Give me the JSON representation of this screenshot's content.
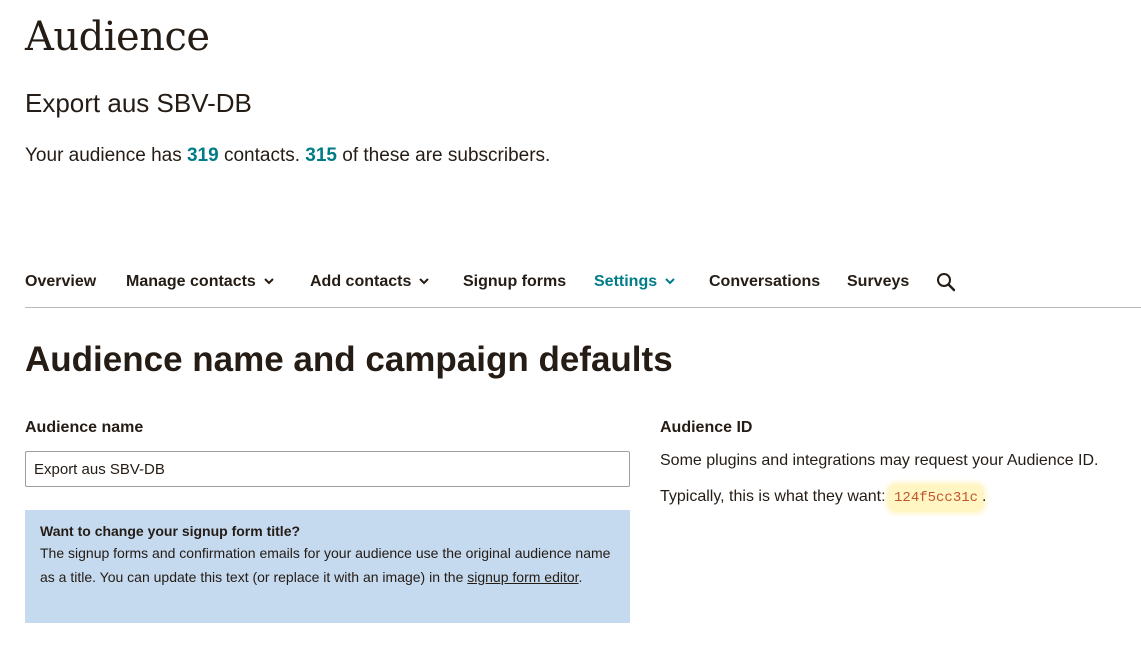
{
  "page": {
    "title": "Audience",
    "audience_name": "Export aus SBV-DB"
  },
  "summary": {
    "prefix": "Your audience has ",
    "contacts_count": "319",
    "middle": " contacts. ",
    "subscribers_count": "315",
    "suffix": " of these are subscribers.",
    "accent_color": "#007c89"
  },
  "nav": {
    "items": [
      {
        "label": "Overview"
      },
      {
        "label": "Manage contacts",
        "dropdown": true
      },
      {
        "label": "Add contacts",
        "dropdown": true
      },
      {
        "label": "Signup forms"
      },
      {
        "label": "Settings",
        "dropdown": true,
        "active": true
      },
      {
        "label": "Conversations"
      },
      {
        "label": "Surveys"
      }
    ],
    "search_icon": "search-icon"
  },
  "section": {
    "title": "Audience name and campaign defaults"
  },
  "name_field": {
    "label": "Audience name",
    "value": "Export aus SBV-DB"
  },
  "notice": {
    "title": "Want to change your signup form title?",
    "body": "The signup forms and confirmation emails for your audience use the original audience name as a title. You can update this text (or replace it with an image) in the ",
    "link": "signup form editor",
    "end": ".",
    "background": "#c5d9ef"
  },
  "audience_id": {
    "label": "Audience ID",
    "line1": "Some plugins and integrations may request your Audience ID.",
    "line2_prefix": "Typically, this is what they want: ",
    "value": "124f5cc31c",
    "line2_suffix": "."
  }
}
